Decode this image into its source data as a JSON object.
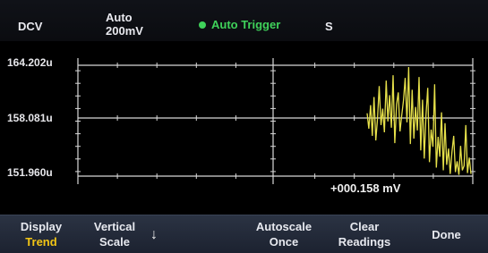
{
  "status": {
    "mode": "DCV",
    "range_line1": "Auto",
    "range_line2": "200mV",
    "trigger": "Auto Trigger",
    "speed": "S",
    "trigger_color": "#3fd15a"
  },
  "plot": {
    "y_labels": [
      "164.202u",
      "158.081u",
      "151.960u"
    ],
    "readout": "+000.158 mV",
    "trace_color": "#e6e04a"
  },
  "chart_data": {
    "type": "line",
    "ylim": [
      151.96,
      164.202
    ],
    "grid": true,
    "series": [
      {
        "values": [
          158.9,
          157.2,
          159.8,
          156.4,
          160.7,
          155.9,
          158.3,
          161.9,
          157.6,
          159.4,
          156.8,
          162.5,
          158.0,
          160.9,
          157.3,
          163.1,
          155.6,
          159.9,
          161.2,
          156.9,
          158.7,
          160.3,
          162.8,
          157.9,
          164.0,
          155.5,
          161.5,
          156.1,
          159.6,
          157.0,
          162.9,
          154.8,
          160.4,
          153.9,
          158.6,
          161.7,
          153.5,
          157.1,
          155.2,
          162.1,
          152.9,
          156.3,
          154.1,
          159.0,
          152.6,
          157.8,
          153.2,
          155.0,
          152.2,
          154.6,
          156.4,
          152.4,
          153.6,
          152.1,
          155.3,
          152.6,
          153.1,
          157.6,
          152.3,
          154.0,
          152.2
        ]
      }
    ]
  },
  "softkeys": [
    {
      "line1": "Display",
      "line2": "Trend",
      "accent": true
    },
    {
      "line1": "Vertical",
      "line2": "Scale",
      "accent": false
    },
    {
      "line1": "",
      "line2": "",
      "accent": false
    },
    {
      "line1": "Autoscale",
      "line2": "Once",
      "accent": false
    },
    {
      "line1": "Clear",
      "line2": "Readings",
      "accent": false
    },
    {
      "line1": "Done",
      "line2": "",
      "accent": false
    }
  ],
  "softkey_arrow": "↓",
  "colors": {
    "accent": "#f2c515",
    "background": "#000000",
    "softkey_bg": "#242b3a"
  }
}
